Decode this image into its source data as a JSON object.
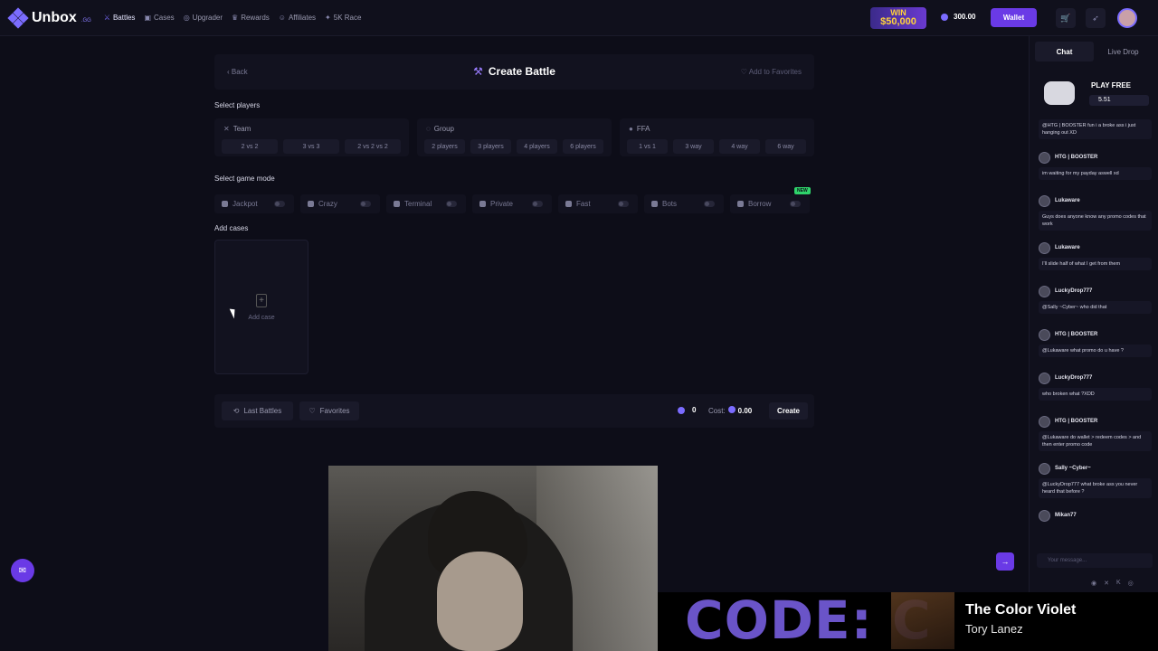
{
  "brand": {
    "name": "Unbox",
    "suffix": ".GG"
  },
  "nav": [
    {
      "label": "Battles",
      "icon": "swords-icon",
      "glyph": "⚔"
    },
    {
      "label": "Cases",
      "icon": "case-icon",
      "glyph": "▣"
    },
    {
      "label": "Upgrader",
      "icon": "upgrader-icon",
      "glyph": "◎"
    },
    {
      "label": "Rewards",
      "icon": "trophy-icon",
      "glyph": "♛"
    },
    {
      "label": "Affiliates",
      "icon": "users-icon",
      "glyph": "☺"
    },
    {
      "label": "5K Race",
      "icon": "race-icon",
      "glyph": "✦"
    }
  ],
  "promo": {
    "line1": "WIN",
    "line2": "$50,000"
  },
  "balance": "300.00",
  "wallet_label": "Wallet",
  "page": {
    "back": "Back",
    "title": "Create Battle",
    "add_to_favorites": "Add to Favorites",
    "select_players": "Select players",
    "select_mode": "Select game mode",
    "add_cases": "Add cases"
  },
  "player_groups": [
    {
      "title": "Team",
      "glyph": "✕",
      "options": [
        "2 vs 2",
        "3 vs 3",
        "2 vs 2 vs 2"
      ]
    },
    {
      "title": "Group",
      "glyph": "◌",
      "options": [
        "2 players",
        "3 players",
        "4 players",
        "6 players"
      ]
    },
    {
      "title": "FFA",
      "glyph": "●",
      "options": [
        "1 vs 1",
        "3 way",
        "4 way",
        "6 way"
      ]
    }
  ],
  "modes": [
    "Jackpot",
    "Crazy",
    "Terminal",
    "Private",
    "Fast",
    "Bots",
    "Borrow"
  ],
  "new_badge": "NEW",
  "add_case_label": "Add case",
  "bottom": {
    "last_battles": "Last Battles",
    "favorites": "Favorites",
    "count": "0",
    "cost_label": "Cost:",
    "cost_value": "0.00",
    "create": "Create"
  },
  "overlay": {
    "code_text": "CODE: C",
    "song_title": "The Color Violet",
    "song_artist": "Tory Lanez"
  },
  "chat": {
    "tabs": [
      "Chat",
      "Live Drop"
    ],
    "play_free": "PLAY FREE",
    "play_free_amount": "5.51",
    "first_message": "@HTG | BOOSTER fun i a broke ass i just hanging out XD",
    "messages": [
      {
        "user": "HTG | BOOSTER",
        "text": "im waiting for my payday aswell xd"
      },
      {
        "user": "Lukaware",
        "text": "Guys does anyone know any promo codes that work"
      },
      {
        "user": "Lukaware",
        "text": "I'll slide half of what I get from them"
      },
      {
        "user": "LuckyDrop777",
        "text": "@Sally ~Cyber~ who did that"
      },
      {
        "user": "HTG | BOOSTER",
        "text": "@Lukaware what promo do u have ?"
      },
      {
        "user": "LuckyDrop777",
        "text": "who broken what ?XDD"
      },
      {
        "user": "HTG | BOOSTER",
        "text": "@Lukaware do wallet > redeem codes > and then enter promo code"
      },
      {
        "user": "Sally ~Cyber~",
        "text": "@LuckyDrop777 what broke ass you never heard that before ?"
      },
      {
        "user": "Mikan77",
        "text": ""
      }
    ],
    "input_placeholder": "Your message..."
  },
  "colors": {
    "accent": "#6a3ae6",
    "brand": "#7b6cff",
    "gold": "#ffd23a",
    "background": "#0d0d18"
  }
}
